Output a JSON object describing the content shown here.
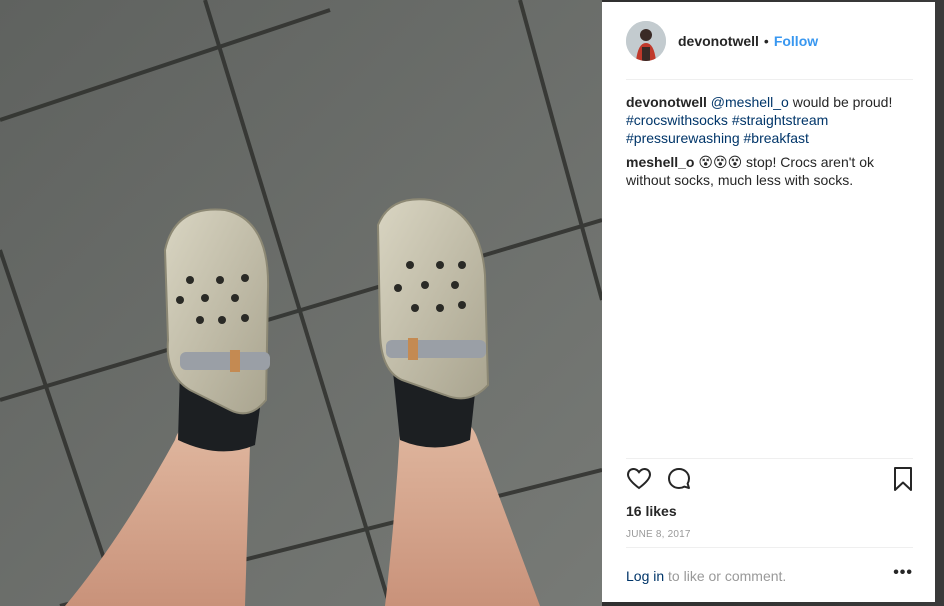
{
  "post": {
    "username": "devonotwell",
    "separator": "•",
    "follow_label": "Follow",
    "caption": {
      "author": "devonotwell",
      "mention": "@meshell_o",
      "text": "would be proud!",
      "hashtags": [
        "#crocswithsocks",
        "#straightstream",
        "#pressurewashing",
        "#breakfast"
      ]
    },
    "comments": [
      {
        "author": "meshell_o",
        "text": "😵😵😵 stop! Crocs aren't ok without socks, much less with socks."
      }
    ],
    "likes": "16 likes",
    "date": "JUNE 8, 2017",
    "footer": {
      "login_label": "Log in",
      "login_suffix": "to like or comment."
    },
    "more_label": "•••"
  },
  "icons": {
    "like": "heart-icon",
    "comment": "comment-icon",
    "save": "bookmark-icon",
    "avatar": "avatar"
  },
  "colors": {
    "link": "#003569",
    "follow": "#3897f0",
    "text": "#262626",
    "muted": "#999999"
  }
}
